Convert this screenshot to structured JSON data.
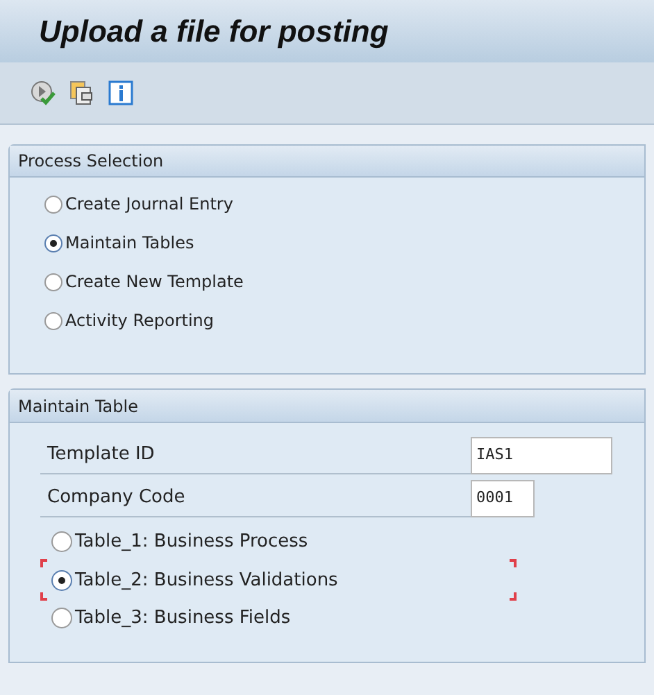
{
  "title": "Upload a file for posting",
  "process_selection": {
    "title": "Process Selection",
    "options": [
      {
        "label": "Create Journal Entry",
        "selected": false
      },
      {
        "label": "Maintain Tables",
        "selected": true
      },
      {
        "label": "Create New Template",
        "selected": false
      },
      {
        "label": "Activity Reporting",
        "selected": false
      }
    ]
  },
  "maintain_table": {
    "title": "Maintain Table",
    "fields": [
      {
        "label": "Template ID",
        "value": "IAS1",
        "kind": "wide"
      },
      {
        "label": "Company Code",
        "value": "0001",
        "kind": "narrow"
      }
    ],
    "options": [
      {
        "label": "Table_1: Business Process",
        "selected": false,
        "focused": false
      },
      {
        "label": "Table_2: Business Validations",
        "selected": true,
        "focused": true
      },
      {
        "label": "Table_3: Business Fields",
        "selected": false,
        "focused": false
      }
    ]
  }
}
